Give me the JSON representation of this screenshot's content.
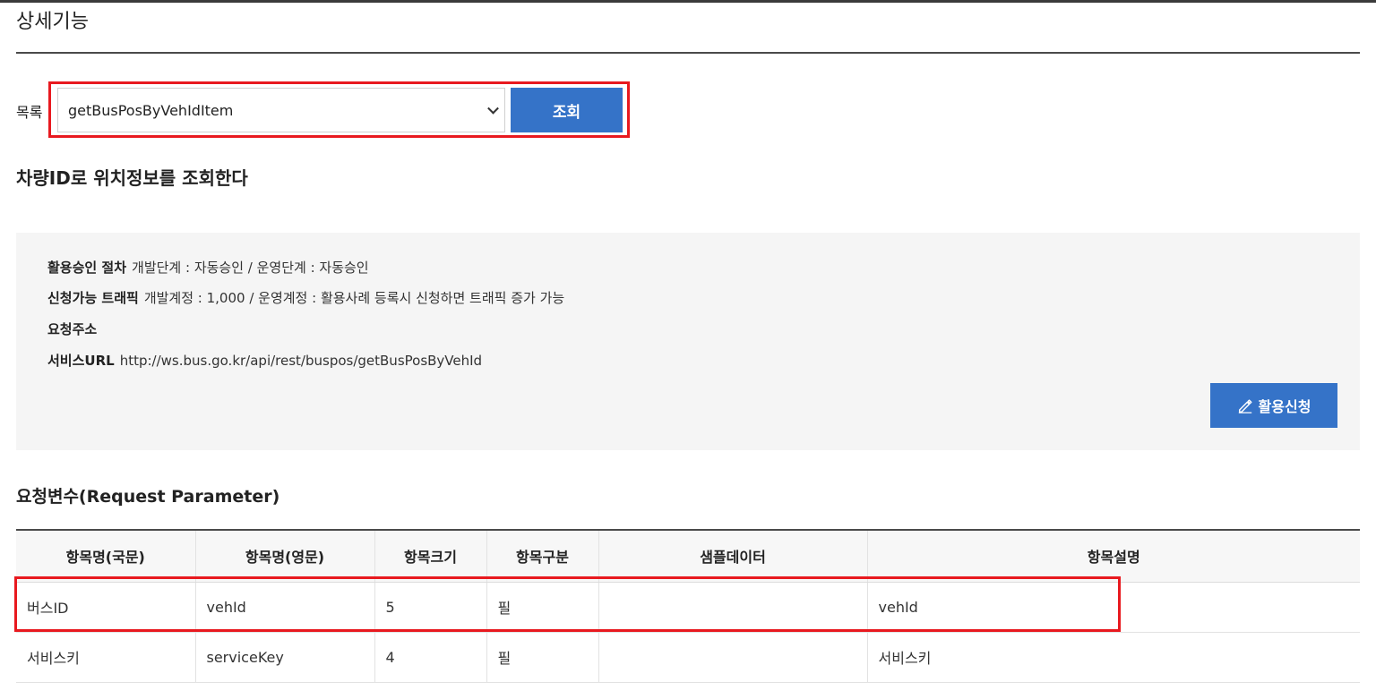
{
  "page": {
    "section_title": "상세기능",
    "list_label": "목록",
    "selected_operation": "getBusPosByVehIdItem",
    "query_button": "조회",
    "operation_description": "차량ID로 위치정보를 조회한다"
  },
  "info": {
    "approval_label": "활용승인 절차",
    "approval_value": "개발단계 : 자동승인 / 운영단계 : 자동승인",
    "traffic_label": "신청가능 트래픽",
    "traffic_value": "개발계정 : 1,000 / 운영계정 : 활용사례 등록시 신청하면 트래픽 증가 가능",
    "request_address_label": "요청주소",
    "service_url_label": "서비스URL",
    "service_url_value": "http://ws.bus.go.kr/api/rest/buspos/getBusPosByVehId",
    "apply_button": "활용신청",
    "apply_icon": "pencil-icon"
  },
  "request_params": {
    "title": "요청변수(Request Parameter)",
    "columns": [
      "항목명(국문)",
      "항목명(영문)",
      "항목크기",
      "항목구분",
      "샘플데이터",
      "항목설명"
    ],
    "rows": [
      [
        "버스ID",
        "vehId",
        "5",
        "필",
        "",
        "vehId"
      ],
      [
        "서비스키",
        "serviceKey",
        "4",
        "필",
        "",
        "서비스키"
      ]
    ]
  },
  "colors": {
    "accent": "#3573c8",
    "highlight": "#e8191f",
    "panel_bg": "#f5f5f5"
  }
}
